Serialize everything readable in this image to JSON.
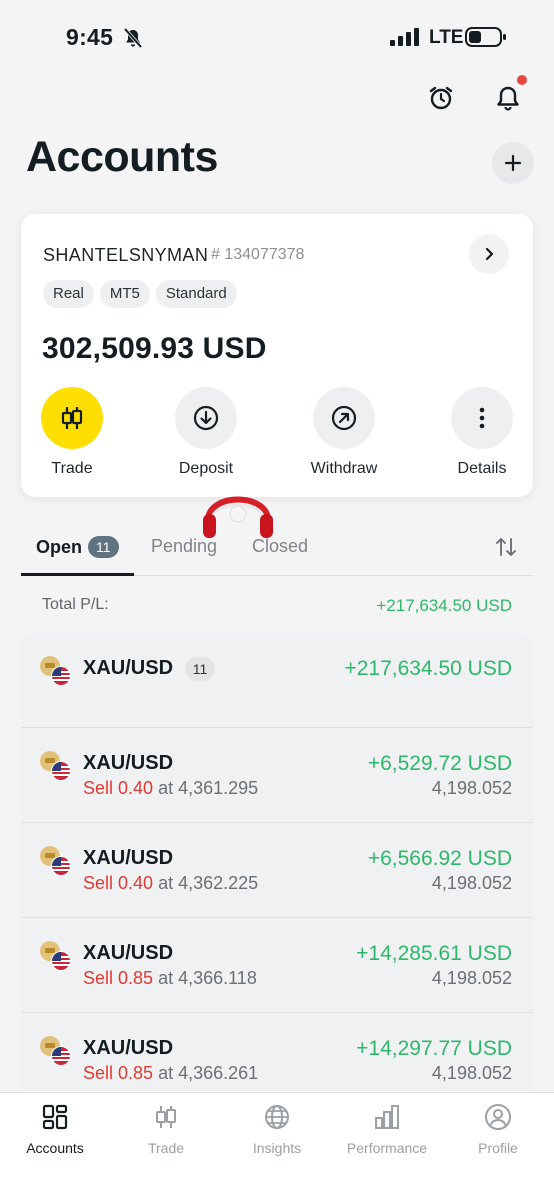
{
  "status_bar": {
    "time": "9:45",
    "network": "LTE"
  },
  "header": {
    "title": "Accounts"
  },
  "account": {
    "name": "SHANTELSNYMAN",
    "number": "# 134077378",
    "tags": [
      "Real",
      "MT5",
      "Standard"
    ],
    "balance": "302,509.93 USD",
    "actions": [
      {
        "label": "Trade",
        "icon": "candles-icon"
      },
      {
        "label": "Deposit",
        "icon": "deposit-icon"
      },
      {
        "label": "Withdraw",
        "icon": "withdraw-icon"
      },
      {
        "label": "Details",
        "icon": "more-icon"
      }
    ]
  },
  "tabs": {
    "open": "Open",
    "open_count": "11",
    "pending": "Pending",
    "closed": "Closed"
  },
  "total": {
    "label": "Total P/L:",
    "value": "+217,634.50 USD"
  },
  "positions": {
    "summary": {
      "symbol": "XAU/USD",
      "count": "11",
      "pl": "+217,634.50 USD"
    },
    "items": [
      {
        "symbol": "XAU/USD",
        "side": "Sell 0.40",
        "open": "at 4,361.295",
        "pl": "+6,529.72 USD",
        "current": "4,198.052"
      },
      {
        "symbol": "XAU/USD",
        "side": "Sell 0.40",
        "open": "at 4,362.225",
        "pl": "+6,566.92 USD",
        "current": "4,198.052"
      },
      {
        "symbol": "XAU/USD",
        "side": "Sell 0.85",
        "open": "at 4,366.118",
        "pl": "+14,285.61 USD",
        "current": "4,198.052"
      },
      {
        "symbol": "XAU/USD",
        "side": "Sell 0.85",
        "open": "at 4,366.261",
        "pl": "+14,297.77 USD",
        "current": "4,198.052"
      }
    ]
  },
  "nav": {
    "items": [
      {
        "label": "Accounts",
        "icon": "accounts-icon"
      },
      {
        "label": "Trade",
        "icon": "trade-icon"
      },
      {
        "label": "Insights",
        "icon": "globe-icon"
      },
      {
        "label": "Performance",
        "icon": "bar-chart-icon"
      },
      {
        "label": "Profile",
        "icon": "profile-icon"
      }
    ]
  },
  "colors": {
    "accent": "#ffde02",
    "profit": "#2eb86a",
    "sell": "#e03b33",
    "badge": "#5f7480"
  }
}
